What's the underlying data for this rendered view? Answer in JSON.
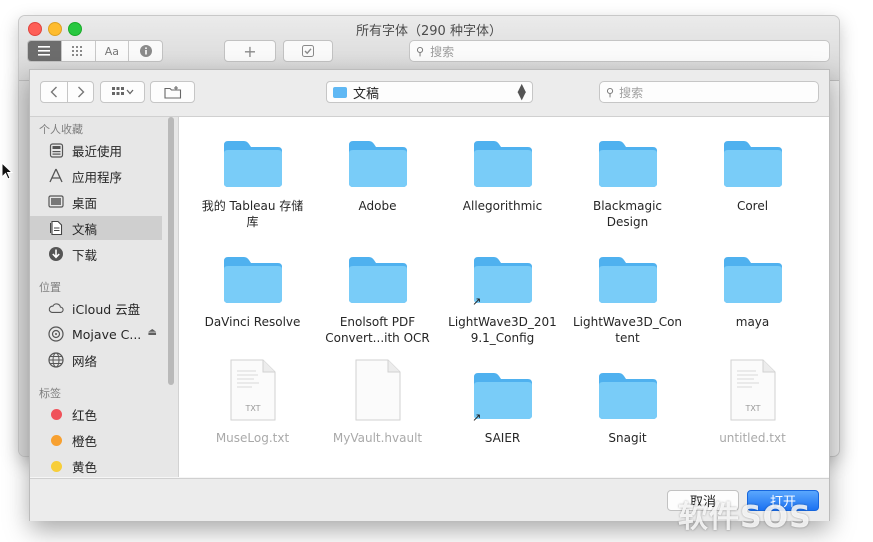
{
  "font_book": {
    "title": "所有字体（290 种字体）",
    "view_buttons": [
      "list-view",
      "grid-view",
      "sample-view",
      "info-view"
    ],
    "sample_label": "Aa",
    "add_label": "+",
    "search_placeholder": "搜索"
  },
  "sheet": {
    "location_label": "文稿",
    "search_placeholder": "搜索",
    "sidebar": {
      "favorites_heading": "个人收藏",
      "favorites": [
        {
          "label": "最近使用",
          "icon": "recents-icon"
        },
        {
          "label": "应用程序",
          "icon": "applications-icon"
        },
        {
          "label": "桌面",
          "icon": "desktop-icon"
        },
        {
          "label": "文稿",
          "icon": "documents-icon",
          "selected": true
        },
        {
          "label": "下载",
          "icon": "downloads-icon"
        }
      ],
      "locations_heading": "位置",
      "locations": [
        {
          "label": "iCloud 云盘",
          "icon": "icloud-icon"
        },
        {
          "label": "Mojave C...",
          "icon": "disk-icon"
        },
        {
          "label": "网络",
          "icon": "network-icon"
        }
      ],
      "tags_heading": "标签",
      "tags": [
        {
          "label": "红色",
          "color": "#f0525a"
        },
        {
          "label": "橙色",
          "color": "#f7a030"
        },
        {
          "label": "黄色",
          "color": "#f7ce3a"
        }
      ]
    },
    "files": [
      {
        "name": "我的 Tableau 存储库",
        "line1": "我的 Tableau 存储",
        "line2": "库",
        "type": "folder"
      },
      {
        "name": "Adobe",
        "line1": "Adobe",
        "line2": "",
        "type": "folder"
      },
      {
        "name": "Allegorithmic",
        "line1": "Allegorithmic",
        "line2": "",
        "type": "folder"
      },
      {
        "name": "Blackmagic Design",
        "line1": "Blackmagic",
        "line2": "Design",
        "type": "folder"
      },
      {
        "name": "Corel",
        "line1": "Corel",
        "line2": "",
        "type": "folder"
      },
      {
        "name": "DaVinci Resolve",
        "line1": "DaVinci Resolve",
        "line2": "",
        "type": "folder"
      },
      {
        "name": "Enolsoft PDF Convert...ith OCR",
        "line1": "Enolsoft PDF",
        "line2": "Convert...ith OCR",
        "type": "folder"
      },
      {
        "name": "LightWave3D_2019.1_Config",
        "line1": "LightWave3D_201",
        "line2": "9.1_Config",
        "type": "alias"
      },
      {
        "name": "LightWave3D_Content",
        "line1": "LightWave3D_Con",
        "line2": "tent",
        "type": "folder"
      },
      {
        "name": "maya",
        "line1": "maya",
        "line2": "",
        "type": "folder"
      },
      {
        "name": "MuseLog.txt",
        "line1": "MuseLog.txt",
        "line2": "",
        "type": "txt",
        "badge": "TXT"
      },
      {
        "name": "MyVault.hvault",
        "line1": "MyVault.hvault",
        "line2": "",
        "type": "doc"
      },
      {
        "name": "SAIER",
        "line1": "SAIER",
        "line2": "",
        "type": "alias"
      },
      {
        "name": "Snagit",
        "line1": "Snagit",
        "line2": "",
        "type": "folder"
      },
      {
        "name": "untitled.txt",
        "line1": "untitled.txt",
        "line2": "",
        "type": "txt",
        "badge": "TXT"
      }
    ],
    "cancel_label": "取消",
    "open_label": "打开"
  },
  "watermark": "软件SOS",
  "colors": {
    "accent": "#1c72f2",
    "folder": "#6cc4f7"
  }
}
